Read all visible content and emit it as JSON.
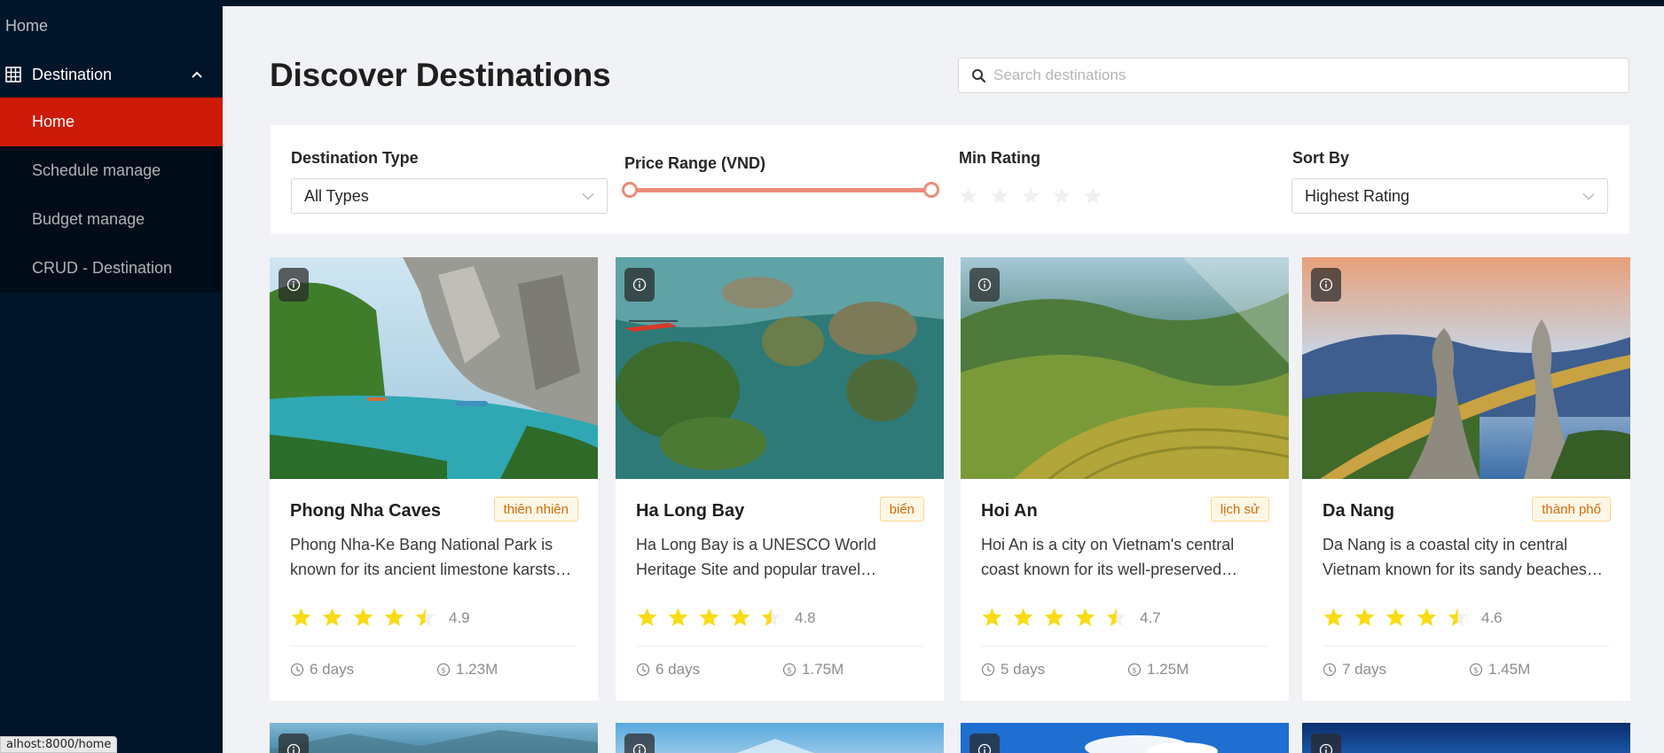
{
  "sidebar": {
    "top_item": "Home",
    "group": {
      "label": "Destination",
      "icon": "table-icon",
      "expanded": true
    },
    "items": [
      {
        "label": "Home",
        "active": true
      },
      {
        "label": "Schedule manage",
        "active": false
      },
      {
        "label": "Budget manage",
        "active": false
      },
      {
        "label": "CRUD - Destination",
        "active": false
      }
    ]
  },
  "header": {
    "title": "Discover Destinations",
    "search_placeholder": "Search destinations",
    "search_value": ""
  },
  "filters": {
    "type_label": "Destination Type",
    "type_value": "All Types",
    "price_label": "Price Range (VND)",
    "price_range_fraction": [
      0,
      1
    ],
    "rating_label": "Min Rating",
    "rating_value": 0,
    "sort_label": "Sort By",
    "sort_value": "Highest Rating"
  },
  "cards": [
    {
      "name": "Phong Nha Caves",
      "tag": "thiên nhiên",
      "description": "Phong Nha-Ke Bang National Park is known for its ancient limestone karsts and caves.",
      "rating": "4.9",
      "stars": 4.5,
      "duration": "6 days",
      "price": "1.23M",
      "image": "cave-river-photo"
    },
    {
      "name": "Ha Long Bay",
      "tag": "biển",
      "description": "Ha Long Bay is a UNESCO World Heritage Site and popular travel destination in Vietnam.",
      "rating": "4.8",
      "stars": 4.5,
      "duration": "6 days",
      "price": "1.75M",
      "image": "bay-islands-photo"
    },
    {
      "name": "Hoi An",
      "tag": "lịch sử",
      "description": "Hoi An is a city on Vietnam's central coast known for its well-preserved Ancient Town.",
      "rating": "4.7",
      "stars": 4.5,
      "duration": "5 days",
      "price": "1.25M",
      "image": "rice-terraces-photo"
    },
    {
      "name": "Da Nang",
      "tag": "thành phố",
      "description": "Da Nang is a coastal city in central Vietnam known for its sandy beaches and bridges.",
      "rating": "4.6",
      "stars": 4.5,
      "duration": "7 days",
      "price": "1.45M",
      "image": "golden-bridge-photo"
    }
  ],
  "status_url": "alhost:8000/home",
  "colors": {
    "sidebar_bg": "#001529",
    "active_item": "#cc1a06",
    "slider": "#ee8b7a",
    "star_filled": "#fadb14",
    "star_empty": "#f0f0f0",
    "tag_text": "#d46b08",
    "tag_bg": "#fff7e6"
  }
}
